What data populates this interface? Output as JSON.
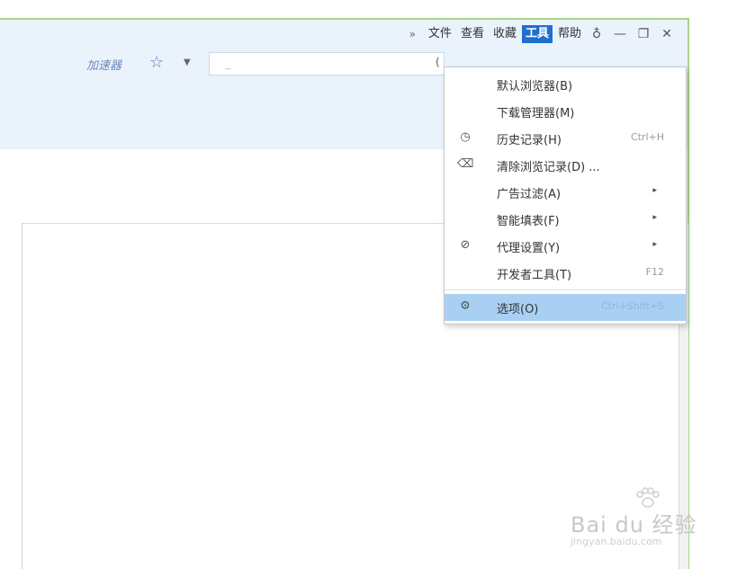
{
  "menubar": {
    "overflow_icon": "double-chevron-right-icon",
    "overflow_glyph": "»",
    "items": [
      {
        "label": "文件",
        "active": false
      },
      {
        "label": "查看",
        "active": false
      },
      {
        "label": "收藏",
        "active": false
      },
      {
        "label": "工具",
        "active": true
      },
      {
        "label": "帮助",
        "active": false
      }
    ],
    "skin_icon": "tshirt-icon",
    "skin_glyph": "♁",
    "minimize_glyph": "—",
    "restore_glyph": "❐",
    "close_glyph": "✕"
  },
  "toolbar": {
    "accelerator_label": "加速器",
    "favorite_star": "☆",
    "favorite_dropdown": "▼",
    "search_value": "",
    "search_placeholder": "",
    "search_adornment": "("
  },
  "tools_menu": {
    "items": [
      {
        "label": "默认浏览器(B)",
        "icon": "",
        "shortcut": "",
        "submenu": false
      },
      {
        "label": "下载管理器(M)",
        "icon": "",
        "shortcut": "",
        "submenu": false
      },
      {
        "label": "历史记录(H)",
        "icon": "clock-icon",
        "icon_glyph": "◷",
        "shortcut": "Ctrl+H",
        "submenu": false
      },
      {
        "label": "清除浏览记录(D) ...",
        "icon": "eraser-icon",
        "icon_glyph": "⌫",
        "shortcut": "",
        "submenu": false
      },
      {
        "label": "广告过滤(A)",
        "icon": "",
        "shortcut": "",
        "submenu": true
      },
      {
        "label": "智能填表(F)",
        "icon": "",
        "shortcut": "",
        "submenu": true
      },
      {
        "label": "代理设置(Y)",
        "icon": "link-icon",
        "icon_glyph": "⊘",
        "shortcut": "",
        "submenu": true
      },
      {
        "label": "开发者工具(T)",
        "icon": "",
        "shortcut": "F12",
        "submenu": false
      },
      {
        "label": "选项(O)",
        "icon": "gear-icon",
        "icon_glyph": "⚙",
        "shortcut": "Ctrl+Shift+S",
        "submenu": false,
        "highlighted": true
      }
    ],
    "submenu_arrow": "▸",
    "highlight_color": "#a9d0f3"
  },
  "watermark": {
    "brand": "Bai du 经验",
    "url": "jingyan.baidu.com"
  },
  "colors": {
    "chrome_bg": "#eaf3fc",
    "active_menu": "#1f6fd1",
    "window_border": "#a7d48c"
  }
}
